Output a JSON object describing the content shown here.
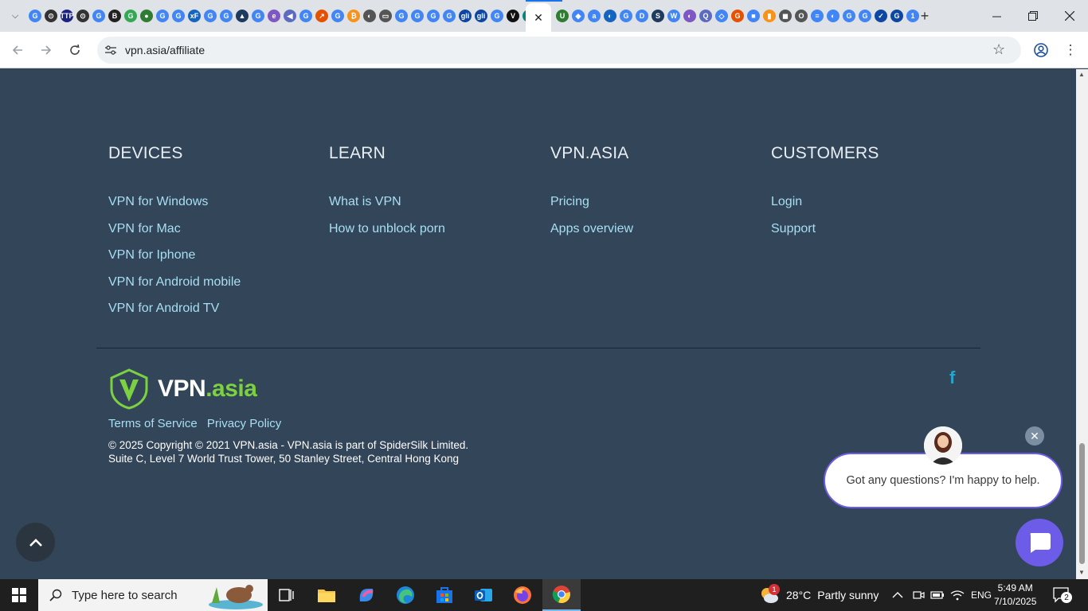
{
  "browser": {
    "url": "vpn.asia/affiliate",
    "active_tab_close": "✕",
    "tab_favicons": [
      "G",
      "⊙",
      "TTP",
      "⊙",
      "G",
      "B",
      "G",
      "●",
      "G",
      "G",
      "xF",
      "G",
      "G",
      "▲",
      "G",
      "e",
      "◀",
      "G",
      "↗",
      "G",
      "₿",
      "◐",
      "▭",
      "G",
      "G",
      "G",
      "G",
      "gli",
      "gli",
      "G",
      "V",
      "◈"
    ],
    "tab_favicons_after": [
      "U",
      "◆",
      "a",
      "◐",
      "G",
      "D",
      "S",
      "W",
      "◐",
      "Q",
      "◇",
      "G",
      "■",
      "▮",
      "◼",
      "O",
      "≡",
      "◐",
      "G",
      "G",
      "✓",
      "G",
      "1"
    ]
  },
  "footer": {
    "columns": [
      {
        "heading": "DEVICES",
        "links": [
          "VPN for Windows",
          "VPN for Mac",
          "VPN for Iphone",
          "VPN for Android mobile",
          "VPN for Android TV"
        ]
      },
      {
        "heading": "LEARN",
        "links": [
          "What is VPN",
          "How to unblock porn"
        ]
      },
      {
        "heading": "VPN.ASIA",
        "links": [
          "Pricing",
          "Apps overview"
        ]
      },
      {
        "heading": "CUSTOMERS",
        "links": [
          "Login",
          "Support"
        ]
      }
    ],
    "logo_main": "VPN",
    "logo_accent": ".asia",
    "terms": "Terms of Service",
    "privacy": "Privacy Policy",
    "copyright_line1": "© 2025 Copyright © 2021 VPN.asia - VPN.asia is part of SpiderSilk Limited.",
    "copyright_line2": "Suite C, Level 7 World Trust Tower, 50 Stanley Street, Central Hong Kong",
    "facebook": "f"
  },
  "chat": {
    "message": "Got any questions? I'm happy to help.",
    "close": "✕"
  },
  "taskbar": {
    "search_placeholder": "Type here to search",
    "weather_temp": "28°C",
    "weather_desc": "Partly sunny",
    "weather_badge": "1",
    "language": "ENG",
    "time": "5:49 AM",
    "date": "7/10/2025",
    "notifications": "2"
  },
  "colors": {
    "page_bg": "#324559",
    "link": "#a8dff2",
    "brand_green": "#7cd142",
    "chat_accent": "#6c5ce7"
  }
}
